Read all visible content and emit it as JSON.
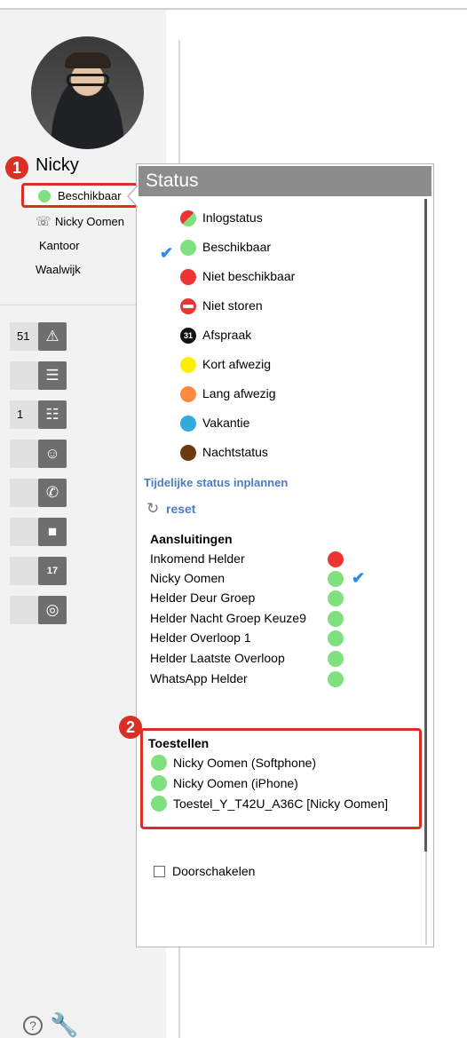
{
  "user": {
    "name": "Nicky",
    "status_label": "Beschikbaar",
    "phone_line": "Nicky Oomen",
    "location": "Kantoor",
    "city": "Waalwijk"
  },
  "annotations": {
    "badge1": "1",
    "badge2": "2"
  },
  "toolbar": [
    {
      "count": "51",
      "icon": "warning-icon"
    },
    {
      "count": "",
      "icon": "notes-icon"
    },
    {
      "count": "1",
      "icon": "checklist-icon"
    },
    {
      "count": "",
      "icon": "contacts-icon"
    },
    {
      "count": "",
      "icon": "phone-icon"
    },
    {
      "count": "",
      "icon": "video-icon"
    },
    {
      "count": "",
      "icon": "calendar-icon",
      "calendar_text": "17"
    },
    {
      "count": "",
      "icon": "voicemail-icon"
    }
  ],
  "popup": {
    "title": "Status",
    "status_options": [
      {
        "label": "Inlogstatus",
        "color": "split-red-green"
      },
      {
        "label": "Beschikbaar",
        "color": "#7ee07e",
        "selected": true
      },
      {
        "label": "Niet beschikbaar",
        "color": "#ee3333"
      },
      {
        "label": "Niet storen",
        "color": "#ee3333"
      },
      {
        "label": "Afspraak",
        "color": "#111111",
        "icon_text": "31"
      },
      {
        "label": "Kort afwezig",
        "color": "#ffee00"
      },
      {
        "label": "Lang afwezig",
        "color": "#ff8a3d"
      },
      {
        "label": "Vakantie",
        "color": "#33aadd"
      },
      {
        "label": "Nachtstatus",
        "color": "#6b3a0e"
      }
    ],
    "plan_link": "Tijdelijke status inplannen",
    "reset_label": "reset",
    "connections_heading": "Aansluitingen",
    "connections": [
      {
        "label": "Inkomend Helder",
        "color": "#ee3333"
      },
      {
        "label": "Nicky Oomen",
        "color": "#7ee07e",
        "selected": true
      },
      {
        "label": "Helder Deur Groep",
        "color": "#7ee07e"
      },
      {
        "label": "Helder Nacht Groep Keuze9",
        "color": "#7ee07e"
      },
      {
        "label": "Helder Overloop 1",
        "color": "#7ee07e"
      },
      {
        "label": "Helder Laatste Overloop",
        "color": "#7ee07e"
      },
      {
        "label": "WhatsApp Helder",
        "color": "#7ee07e"
      }
    ],
    "devices_heading": "Toestellen",
    "devices": [
      {
        "label": "Nicky Oomen (Softphone)"
      },
      {
        "label": "Nicky Oomen (iPhone)"
      },
      {
        "label": "Toestel_Y_T42U_A36C [Nicky Oomen]"
      }
    ],
    "forward_label": "Doorschakelen"
  },
  "footer": {
    "help_icon": "help-icon",
    "tools_icon": "wrench-icon"
  }
}
